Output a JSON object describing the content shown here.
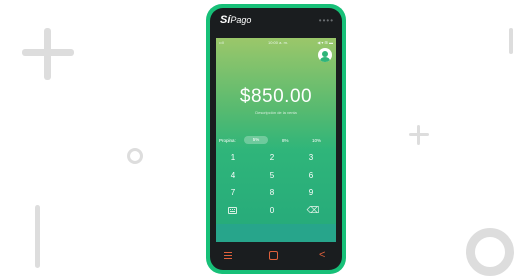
{
  "app": {
    "logo_brand": "Sí",
    "logo_suffix": "Pago"
  },
  "status_bar": {
    "carrier": "••ll",
    "time": "10:00 a. m.",
    "signal": "◀ ▾ ⊞ ▬"
  },
  "payment": {
    "amount": "$850.00",
    "description_placeholder": "Descripción de la venta"
  },
  "tip": {
    "label": "Propina:",
    "options": [
      "5%",
      "8%",
      "10%"
    ],
    "selected": "5%"
  },
  "keypad": {
    "keys": [
      "1",
      "2",
      "3",
      "4",
      "5",
      "6",
      "7",
      "8",
      "9",
      "0"
    ]
  },
  "icons": {
    "menu": "menu-icon",
    "home": "home-icon",
    "back": "back-icon",
    "keyboard": "keyboard-icon",
    "backspace": "backspace-icon",
    "avatar": "user-avatar-icon",
    "more": "more-dots-icon"
  },
  "colors": {
    "phone_frame": "#17c078",
    "screen_gradient_top": "#9bc76a",
    "screen_gradient_bottom": "#25a97a",
    "nav_accent": "#e0613c"
  }
}
